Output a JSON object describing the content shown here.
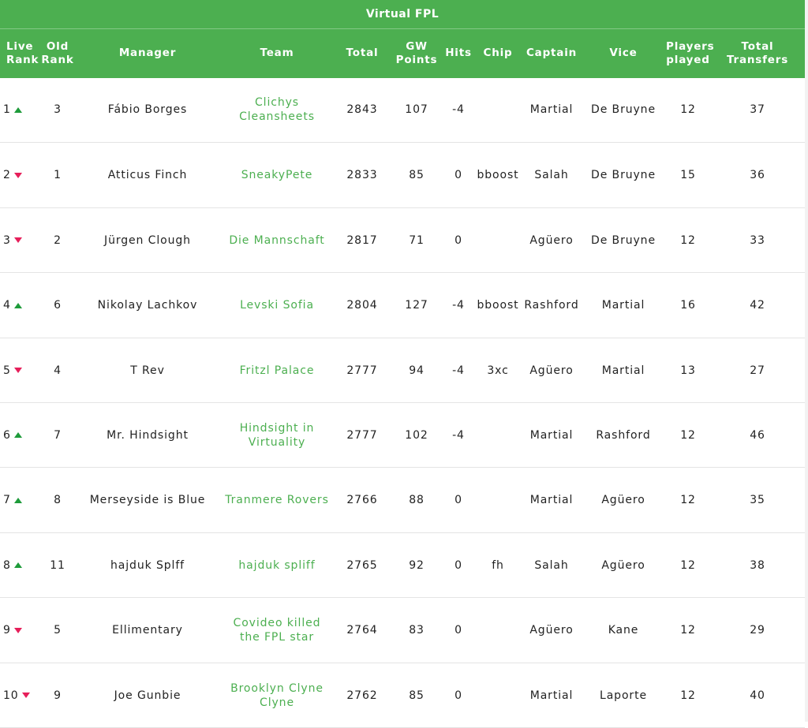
{
  "title": "Virtual FPL",
  "columns": [
    "Live Rank",
    "Old Rank",
    "Manager",
    "Team",
    "Total",
    "GW Points",
    "Hits",
    "Chip",
    "Captain",
    "Vice",
    "Players played",
    "Total Transfers"
  ],
  "colors": {
    "header_bg": "#4caf50",
    "team_text": "#4caf50",
    "rank_up": "#1e9b3a",
    "rank_down": "#e61f5a"
  },
  "rows": [
    {
      "rank": "1",
      "move": "up",
      "old": "3",
      "manager": "Fábio Borges",
      "team": "Clichys Cleansheets",
      "total": "2843",
      "gw": "107",
      "hits": "-4",
      "chip": "",
      "captain": "Martial",
      "vice": "De Bruyne",
      "played": "12",
      "transfers": "37"
    },
    {
      "rank": "2",
      "move": "down",
      "old": "1",
      "manager": "Atticus Finch",
      "team": "SneakyPete",
      "total": "2833",
      "gw": "85",
      "hits": "0",
      "chip": "bboost",
      "captain": "Salah",
      "vice": "De Bruyne",
      "played": "15",
      "transfers": "36"
    },
    {
      "rank": "3",
      "move": "down",
      "old": "2",
      "manager": "Jürgen Clough",
      "team": "Die Mannschaft",
      "total": "2817",
      "gw": "71",
      "hits": "0",
      "chip": "",
      "captain": "Agüero",
      "vice": "De Bruyne",
      "played": "12",
      "transfers": "33"
    },
    {
      "rank": "4",
      "move": "up",
      "old": "6",
      "manager": "Nikolay Lachkov",
      "team": "Levski Sofia",
      "total": "2804",
      "gw": "127",
      "hits": "-4",
      "chip": "bboost",
      "captain": "Rashford",
      "vice": "Martial",
      "played": "16",
      "transfers": "42"
    },
    {
      "rank": "5",
      "move": "down",
      "old": "4",
      "manager": "T Rev",
      "team": "Fritzl Palace",
      "total": "2777",
      "gw": "94",
      "hits": "-4",
      "chip": "3xc",
      "captain": "Agüero",
      "vice": "Martial",
      "played": "13",
      "transfers": "27"
    },
    {
      "rank": "6",
      "move": "up",
      "old": "7",
      "manager": "Mr. Hindsight",
      "team": "Hindsight in Virtuality",
      "total": "2777",
      "gw": "102",
      "hits": "-4",
      "chip": "",
      "captain": "Martial",
      "vice": "Rashford",
      "played": "12",
      "transfers": "46"
    },
    {
      "rank": "7",
      "move": "up",
      "old": "8",
      "manager": "Merseyside is Blue",
      "team": "Tranmere Rovers",
      "total": "2766",
      "gw": "88",
      "hits": "0",
      "chip": "",
      "captain": "Martial",
      "vice": "Agüero",
      "played": "12",
      "transfers": "35"
    },
    {
      "rank": "8",
      "move": "up",
      "old": "11",
      "manager": "hajduk Splff",
      "team": "hajduk spliff",
      "total": "2765",
      "gw": "92",
      "hits": "0",
      "chip": "fh",
      "captain": "Salah",
      "vice": "Agüero",
      "played": "12",
      "transfers": "38"
    },
    {
      "rank": "9",
      "move": "down",
      "old": "5",
      "manager": "Ellimentary",
      "team": "Covideo killed the FPL star",
      "total": "2764",
      "gw": "83",
      "hits": "0",
      "chip": "",
      "captain": "Agüero",
      "vice": "Kane",
      "played": "12",
      "transfers": "29"
    },
    {
      "rank": "10",
      "move": "down",
      "old": "9",
      "manager": "Joe Gunbie",
      "team": "Brooklyn Clyne Clyne",
      "total": "2762",
      "gw": "85",
      "hits": "0",
      "chip": "",
      "captain": "Martial",
      "vice": "Laporte",
      "played": "12",
      "transfers": "40"
    }
  ]
}
